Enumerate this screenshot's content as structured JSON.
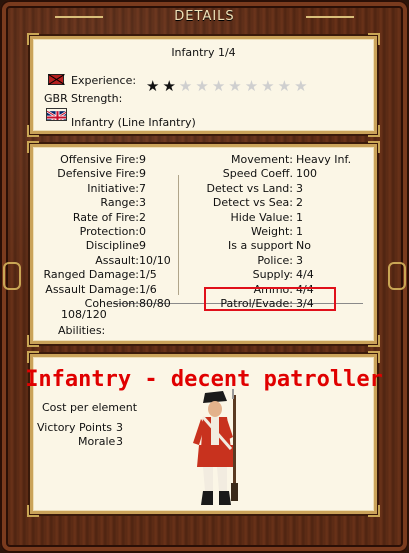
{
  "window": {
    "title": "DETAILS"
  },
  "unit": {
    "title": "Infantry 1/4",
    "experience_label": "Experience:",
    "experience_stars": 2,
    "experience_max": 10,
    "nation_code": "GBR",
    "strength_label": "Strength:",
    "type_label": "Infantry (Line Infantry)"
  },
  "stats": {
    "left": [
      {
        "label": "Offensive Fire:",
        "value": "9"
      },
      {
        "label": "Defensive Fire:",
        "value": "9"
      },
      {
        "label": "Initiative:",
        "value": "7"
      },
      {
        "label": "Range:",
        "value": "3"
      },
      {
        "label": "Rate of Fire:",
        "value": "2"
      },
      {
        "label": "Protection:",
        "value": "0"
      },
      {
        "label": "Discipline",
        "value": "9"
      },
      {
        "label": "Assault:",
        "value": "10/10"
      },
      {
        "label": "Ranged Damage:",
        "value": "1/5"
      },
      {
        "label": "Assault Damage:",
        "value": "1/6"
      },
      {
        "label": "Cohesion:",
        "value": "80/80"
      }
    ],
    "right": [
      {
        "label": "Movement:",
        "value": "Heavy Inf."
      },
      {
        "label": "Speed Coeff.",
        "value": "100"
      },
      {
        "label": "Detect vs Land:",
        "value": "3"
      },
      {
        "label": "Detect vs Sea:",
        "value": "2"
      },
      {
        "label": "Hide Value:",
        "value": "1"
      },
      {
        "label": "Weight:",
        "value": "1"
      },
      {
        "label": "Is a support",
        "value": "No"
      },
      {
        "label": "Police:",
        "value": "3"
      },
      {
        "label": "Supply:",
        "value": "4/4"
      },
      {
        "label": "Ammo:",
        "value": "4/4"
      },
      {
        "label": "Patrol/Evade:",
        "value": "3/4"
      }
    ],
    "hit_points": "108/120",
    "abilities_label": "Abilities:"
  },
  "bottom": {
    "headline": "Infantry - decent patroller",
    "cost_label": "Cost per element",
    "victory_points_label": "Victory Points",
    "victory_points_value": "3",
    "morale_label": "Morale",
    "morale_value": "3"
  },
  "colors": {
    "highlight": "#e0101a",
    "headline": "#e00000",
    "panel": "#fbf6e6",
    "frame": "#5a2a14"
  }
}
